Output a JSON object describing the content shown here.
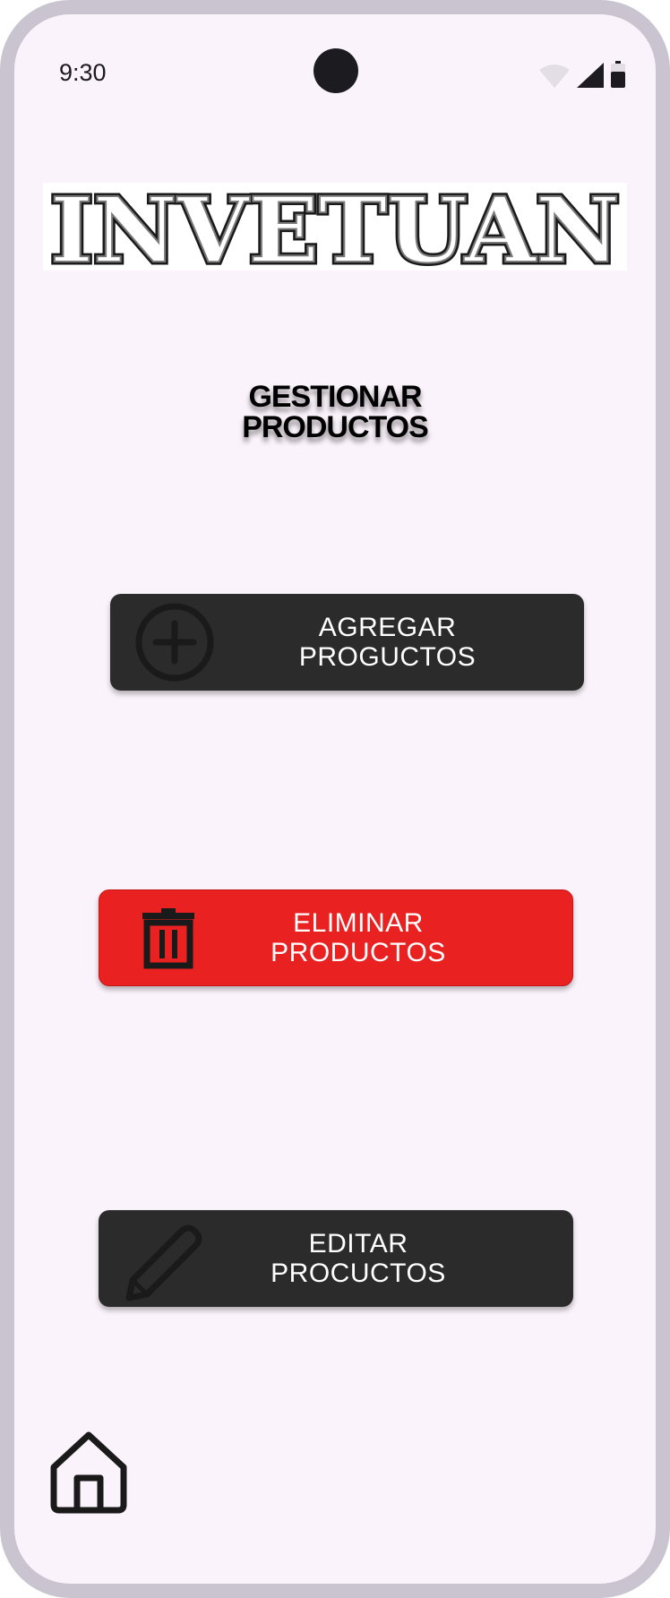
{
  "status_bar": {
    "time": "9:30"
  },
  "logo": {
    "text": "INVETUAN"
  },
  "title": {
    "line1": "GESTIONAR",
    "line2": "PRODUCTOS"
  },
  "buttons": {
    "add": {
      "line1": "AGREGAR",
      "line2": "PROGUCTOS",
      "icon": "add-circle-icon",
      "color": "#2b2b2b"
    },
    "delete": {
      "line1": "ELIMINAR",
      "line2": "PRODUCTOS",
      "icon": "trash-icon",
      "color": "#ea2121"
    },
    "edit": {
      "line1": "EDITAR",
      "line2": "PROCUCTOS",
      "icon": "pencil-icon",
      "color": "#2b2b2b"
    }
  },
  "nav": {
    "home_icon": "home-icon"
  },
  "colors": {
    "background": "#fbf3fb",
    "frame": "#c9c4d0"
  }
}
